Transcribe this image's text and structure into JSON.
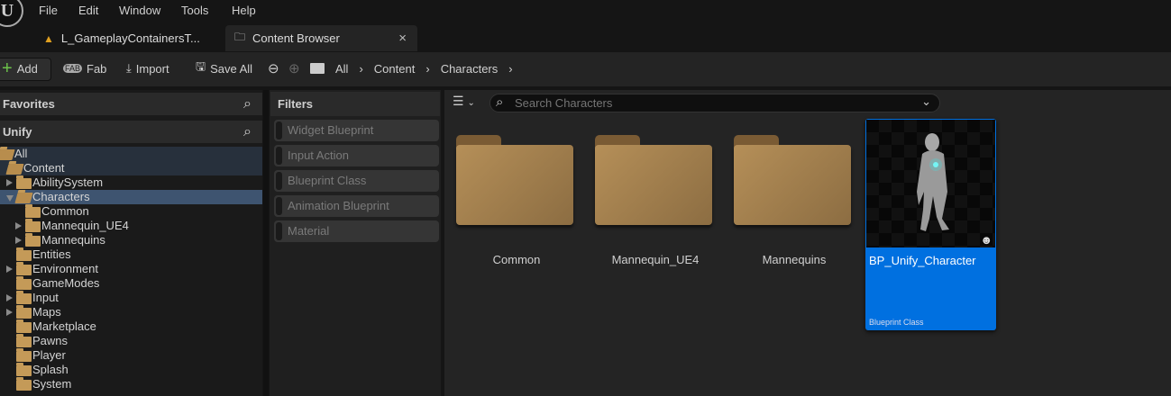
{
  "menu": [
    "File",
    "Edit",
    "Window",
    "Tools",
    "Help"
  ],
  "tabs": [
    {
      "label": "L_GameplayContainersT..."
    },
    {
      "label": "Content Browser",
      "close": "×"
    }
  ],
  "toolbar": {
    "add": "Add",
    "fab": "Fab",
    "import": "Import",
    "save_all": "Save All"
  },
  "breadcrumb": [
    "All",
    "Content",
    "Characters"
  ],
  "sidebar": {
    "favorites": "Favorites",
    "project": "Unify",
    "tree": [
      {
        "label": "All",
        "level": 0,
        "open": true,
        "arrow": false
      },
      {
        "label": "Content",
        "level": 0,
        "open": true,
        "arrow": "down"
      },
      {
        "label": "AbilitySystem",
        "level": 1,
        "arrow": "right"
      },
      {
        "label": "Characters",
        "level": 1,
        "open": true,
        "arrow": "down",
        "selected": true
      },
      {
        "label": "Common",
        "level": 2,
        "arrow": false
      },
      {
        "label": "Mannequin_UE4",
        "level": 2,
        "arrow": "right"
      },
      {
        "label": "Mannequins",
        "level": 2,
        "arrow": "right"
      },
      {
        "label": "Entities",
        "level": 1,
        "arrow": false
      },
      {
        "label": "Environment",
        "level": 1,
        "arrow": "right"
      },
      {
        "label": "GameModes",
        "level": 1,
        "arrow": false
      },
      {
        "label": "Input",
        "level": 1,
        "arrow": "right"
      },
      {
        "label": "Maps",
        "level": 1,
        "arrow": "right"
      },
      {
        "label": "Marketplace",
        "level": 1,
        "arrow": false
      },
      {
        "label": "Pawns",
        "level": 1,
        "arrow": false
      },
      {
        "label": "Player",
        "level": 1,
        "arrow": false
      },
      {
        "label": "Splash",
        "level": 1,
        "arrow": false
      },
      {
        "label": "System",
        "level": 1,
        "arrow": false
      }
    ]
  },
  "filters": {
    "title": "Filters",
    "items": [
      "Widget Blueprint",
      "Input Action",
      "Blueprint Class",
      "Animation Blueprint",
      "Material"
    ]
  },
  "search": {
    "placeholder": "Search Characters"
  },
  "assets": {
    "folders": [
      "Common",
      "Mannequin_UE4",
      "Mannequins"
    ],
    "selected": {
      "name": "BP_Unify_Character",
      "type": "Blueprint Class"
    }
  },
  "colors": {
    "accent": "#0070e0",
    "folder": "#c49a58",
    "selection": "#3e5470"
  }
}
